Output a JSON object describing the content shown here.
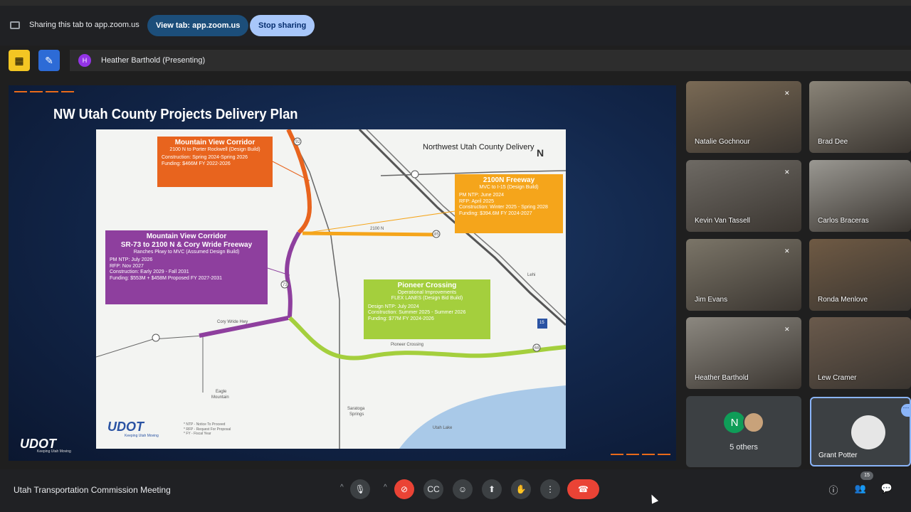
{
  "sharebar": {
    "text": "Sharing this tab to app.zoom.us",
    "view_button": "View tab: app.zoom.us",
    "stop_button": "Stop sharing"
  },
  "presenter": {
    "initial": "H",
    "name": "Heather Barthold (Presenting)"
  },
  "slide": {
    "title": "NW Utah County Projects Delivery Plan",
    "map_title": "Northwest Utah County Delivery",
    "compass": "N",
    "logo": "UDOT",
    "logo_tagline": "Keeping Utah Moving",
    "notes": [
      "* NTP - Notice To Proceed",
      "* RFP - Request For Proposal",
      "* FY - Fiscal Year"
    ],
    "boxes": {
      "orange": {
        "title": "Mountain View Corridor",
        "subtitle": "2100 N to Porter Rockwell (Design Build)",
        "lines": [
          "Construction: Spring 2024-Spring 2026",
          "Funding: $466M FY 2022-2026"
        ]
      },
      "yellow": {
        "title": "2100N Freeway",
        "subtitle": "MVC to I-15 (Design Build)",
        "lines": [
          "PM NTP: June 2024",
          "RFP: April 2025",
          "Construction: Winter 2025 - Spring 2028",
          "Funding: $394.6M FY 2024-2027"
        ]
      },
      "purple": {
        "title": "Mountain View Corridor",
        "title2": "SR-73 to 2100 N & Cory Wride Freeway",
        "subtitle": "Ranches Pkwy to MVC (Assumed Design Build)",
        "lines": [
          "PM NTP: July 2026",
          "RFP: Nov 2027",
          "Construction: Early 2029 - Fall 2031",
          "Funding: $553M + $458M  Proposed FY 2027-2031"
        ]
      },
      "green": {
        "title": "Pioneer Crossing",
        "subtitle": "Operational Improvements",
        "subtitle2": "FLEX LANES (Design Bid Build)",
        "lines": [
          "Design NTP: July 2024",
          "Construction: Summer 2025 - Summer 2026",
          "Funding: $77M FY 2024-2026"
        ]
      }
    },
    "map_labels": {
      "road_2100n": "2100 N",
      "cory_wride": "Cory Wride Hwy",
      "pioneer": "Pioneer Crossing",
      "eagle": "Eagle",
      "mountain": "Mountain",
      "saratoga": "Saratoga",
      "springs": "Springs",
      "utah_lake": "Utah Lake",
      "lehi": "Lehi",
      "i15": "15",
      "r92": "92",
      "r73": "73",
      "r85": "85",
      "r68": "68"
    }
  },
  "participants": [
    {
      "name": "Natalie Gochnour",
      "bg": "#7a6a55"
    },
    {
      "name": "Brad Dee",
      "bg": "#8a8478"
    },
    {
      "name": "Kevin Van Tassell",
      "bg": "#6e6a64"
    },
    {
      "name": "Carlos Braceras",
      "bg": "#9a9892"
    },
    {
      "name": "Jim Evans",
      "bg": "#7b7568"
    },
    {
      "name": "Ronda Menlove",
      "bg": "#6f5a44"
    },
    {
      "name": "Heather Barthold",
      "bg": "#8c8880"
    },
    {
      "name": "Lew Cramer",
      "bg": "#6a5a4c"
    }
  ],
  "others": {
    "initial": "N",
    "label": "5 others"
  },
  "self": {
    "name": "Grant Potter"
  },
  "bottombar": {
    "meeting_title": "Utah Transportation Commission Meeting",
    "people_count": "15"
  }
}
